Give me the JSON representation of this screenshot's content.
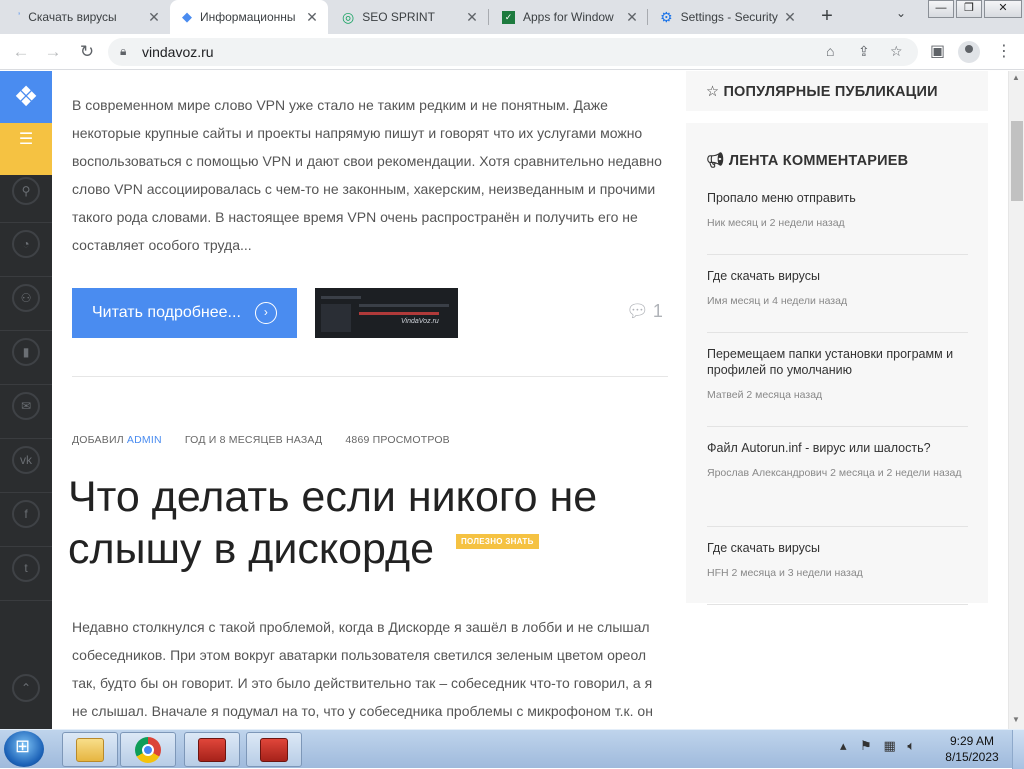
{
  "browser": {
    "tabs": [
      {
        "title": "Скачать вирусы",
        "icon": "vindavoz-favicon",
        "active": false
      },
      {
        "title": "Информационны",
        "icon": "diamond-favicon",
        "active": true
      },
      {
        "title": "SEO SPRINT",
        "icon": "seosprint-favicon",
        "active": false
      },
      {
        "title": "Apps for Window",
        "icon": "spreadsheet-favicon",
        "active": false
      },
      {
        "title": "Settings - Security",
        "icon": "gear-favicon",
        "active": false
      }
    ],
    "url": "vindavoz.ru"
  },
  "article1": {
    "excerpt": "В современном мире слово VPN уже стало не таким редким и не понятным. Даже некоторые крупные сайты и проекты напрямую пишут и говорят что их услугами можно воспользоваться с помощью VPN и дают свои рекомендации. Хотя сравнительно недавно слово VPN ассоциировалась с чем-то не законным, хакерским, неизведанным и прочими такого рода словами. В настоящее время VPN очень распространён и получить его не составляет особого труда...",
    "read_more": "Читать подробнее...",
    "thumb_brand": "VindaVoz.ru",
    "comment_count": "1"
  },
  "article2": {
    "meta_added": "ДОБАВИЛ",
    "meta_author": "ADMIN",
    "meta_date": "ГОД И 8 МЕСЯЦЕВ НАЗАД",
    "meta_views": "4869 ПРОСМОТРОВ",
    "title": "Что делать если никого не слышу в дискорде",
    "badge": "ПОЛЕЗНО ЗНАТЬ",
    "body": "Недавно столкнулся с такой проблемой, когда в Дискорде я зашёл в лобби и не слышал собеседников. При этом вокруг аватарки пользователя светился зеленым цветом ореол так, будто бы он говорит. И это было действительно так – собеседник что-то говорил, а я не слышал. Вначале я подумал на то, что у собеседника проблемы с микрофоном т.к. он"
  },
  "sidebar": {
    "popular_title": "ПОПУЛЯРНЫЕ ПУБЛИКАЦИИ",
    "comments_title": "ЛЕНТА КОММЕНТАРИЕВ",
    "comments": [
      {
        "title": "Пропало меню отправить",
        "meta": "Ник месяц и 2 недели назад"
      },
      {
        "title": "Где скачать вирусы",
        "meta": "Имя месяц и 4 недели назад"
      },
      {
        "title": "Перемещаем папки установки программ и профилей по умолчанию",
        "meta": "Матвей 2 месяца назад"
      },
      {
        "title": "Файл Autorun.inf - вирус или шалость?",
        "meta": "Ярослав Александрович 2 месяца и 2 недели назад"
      },
      {
        "title": "Где скачать вирусы",
        "meta": "HFH 2 месяца и 3 недели назад"
      }
    ]
  },
  "taskbar": {
    "time": "9:29 AM",
    "date": "8/15/2023"
  },
  "colors": {
    "accent_blue": "#4a8cf0",
    "accent_yellow": "#f5c242",
    "sidebar_dark": "#2b2d2f"
  }
}
